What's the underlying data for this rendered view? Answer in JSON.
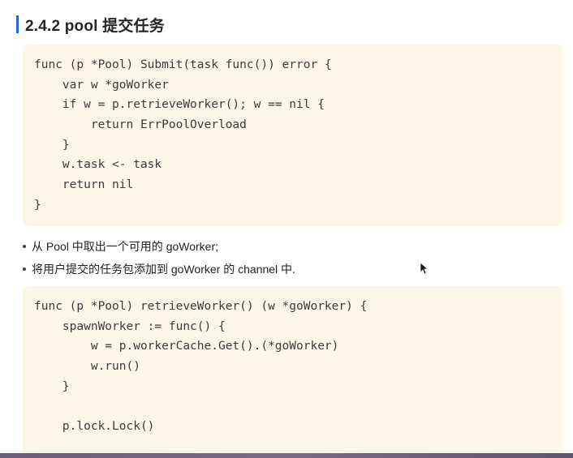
{
  "section": {
    "title": "2.4.2 pool 提交任务"
  },
  "code_block_1": {
    "lines": [
      "func (p *Pool) Submit(task func()) error {",
      "    var w *goWorker",
      "    if w = p.retrieveWorker(); w == nil {",
      "        return ErrPoolOverload",
      "    }",
      "    w.task <- task",
      "    return nil",
      "}"
    ]
  },
  "bullets": [
    "从 Pool 中取出一个可用的 goWorker;",
    "将用户提交的任务包添加到 goWorker 的 channel 中."
  ],
  "code_block_2": {
    "lines": [
      "func (p *Pool) retrieveWorker() (w *goWorker) {",
      "    spawnWorker := func() {",
      "        w = p.workerCache.Get().(*goWorker)",
      "        w.run()",
      "    }",
      "",
      "    p.lock.Lock()"
    ]
  },
  "colors": {
    "heading_accent": "#2d63d8",
    "code_background": "#fcf6e6"
  },
  "icons": {
    "cursor": "mouse-pointer-icon"
  }
}
